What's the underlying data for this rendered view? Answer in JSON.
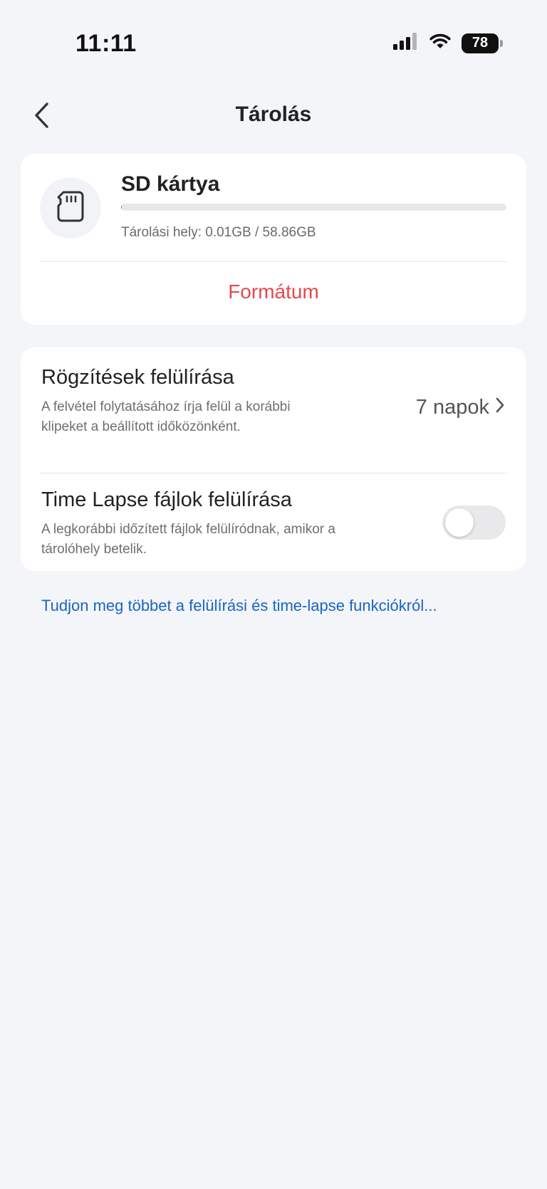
{
  "status_bar": {
    "time": "11:11",
    "battery": "78"
  },
  "header": {
    "title": "Tárolás"
  },
  "sd_card": {
    "title": "SD kártya",
    "storage_text": "Tárolási hely: 0.01GB / 58.86GB",
    "used_fraction": 0.0002,
    "format_label": "Formátum"
  },
  "settings": {
    "overwrite_recordings": {
      "title": "Rögzítések felülírása",
      "description": "A felvétel folytatásához írja felül a korábbi klipeket a beállított időközönként.",
      "value": "7 napok"
    },
    "overwrite_timelapse": {
      "title": "Time Lapse fájlok felülírása",
      "description": "A legkorábbi időzített fájlok felülíródnak, amikor a tárolóhely betelik.",
      "enabled": false
    }
  },
  "learn_more_link": "Tudjon meg többet a felülírási és time-lapse funkciókról...",
  "colors": {
    "background": "#f3f5f8",
    "card": "#ffffff",
    "destructive": "#e5484d",
    "link": "#1a64c8",
    "toggle_off": "#e9e9eb"
  }
}
